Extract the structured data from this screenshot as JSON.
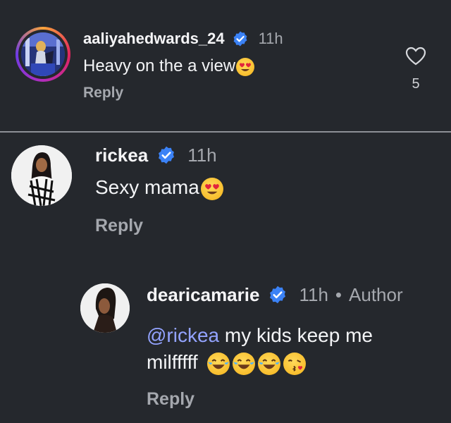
{
  "comments": [
    {
      "username": "aaliyahedwards_24",
      "time": "11h",
      "text": "Heavy on the a view",
      "emojis": [
        "heart-eyes"
      ],
      "reply_label": "Reply",
      "like_count": "5",
      "verified": true
    },
    {
      "username": "rickea",
      "time": "11h",
      "text": "Sexy mama",
      "emojis": [
        "heart-eyes"
      ],
      "reply_label": "Reply",
      "verified": true
    },
    {
      "username": "dearicamarie",
      "time": "11h",
      "separator": "•",
      "badge": "Author",
      "mention": "@rickea",
      "text_line1": " my kids keep me",
      "text_line2": "milfffff",
      "emojis": [
        "tears-of-joy",
        "tears-of-joy",
        "tears-of-joy",
        "kissing-heart"
      ],
      "reply_label": "Reply",
      "verified": true
    }
  ],
  "colors": {
    "background": "#25282d",
    "mention": "#93a3ff",
    "verified": "#3b82f6",
    "muted": "#a5a8ae"
  }
}
